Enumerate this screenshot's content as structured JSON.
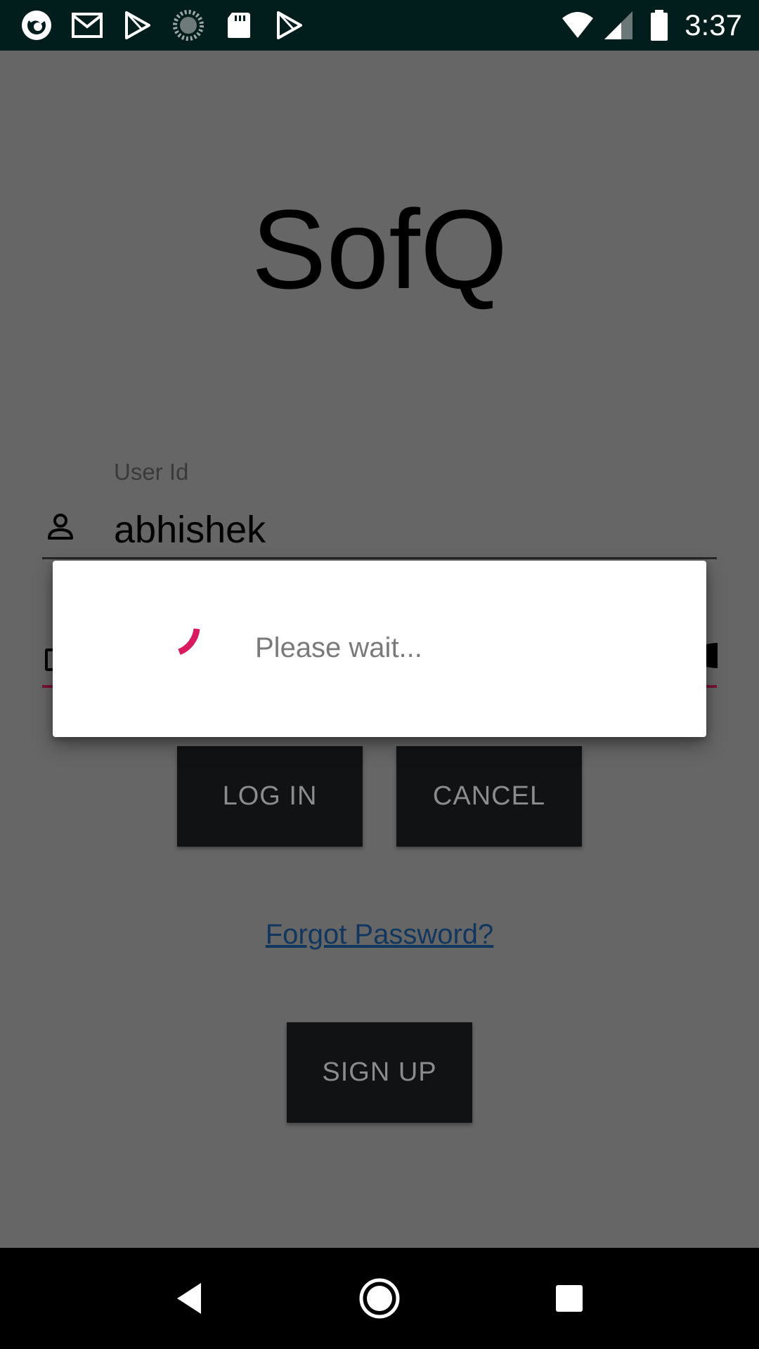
{
  "status_bar": {
    "time": "3:37",
    "notification_icons": [
      "blue-ring-app-icon",
      "gmail-icon",
      "play-store-icon",
      "sync-progress-icon",
      "sd-card-icon",
      "play-store-icon"
    ],
    "system_icons": [
      "wifi-icon",
      "cell-signal-icon",
      "battery-icon"
    ]
  },
  "app": {
    "title": "SofQ"
  },
  "form": {
    "user_id_label": "User Id",
    "user_id_value": "abhishek",
    "accent_color": "#c2185b"
  },
  "buttons": {
    "login": "LOG IN",
    "cancel": "CANCEL",
    "signup": "SIGN UP"
  },
  "links": {
    "forgot_password": "Forgot Password?"
  },
  "dialog": {
    "message": "Please wait...",
    "spinner_color": "#d81b60"
  },
  "nav_bar": {
    "icons": [
      "back-icon",
      "home-icon",
      "recents-icon"
    ]
  }
}
